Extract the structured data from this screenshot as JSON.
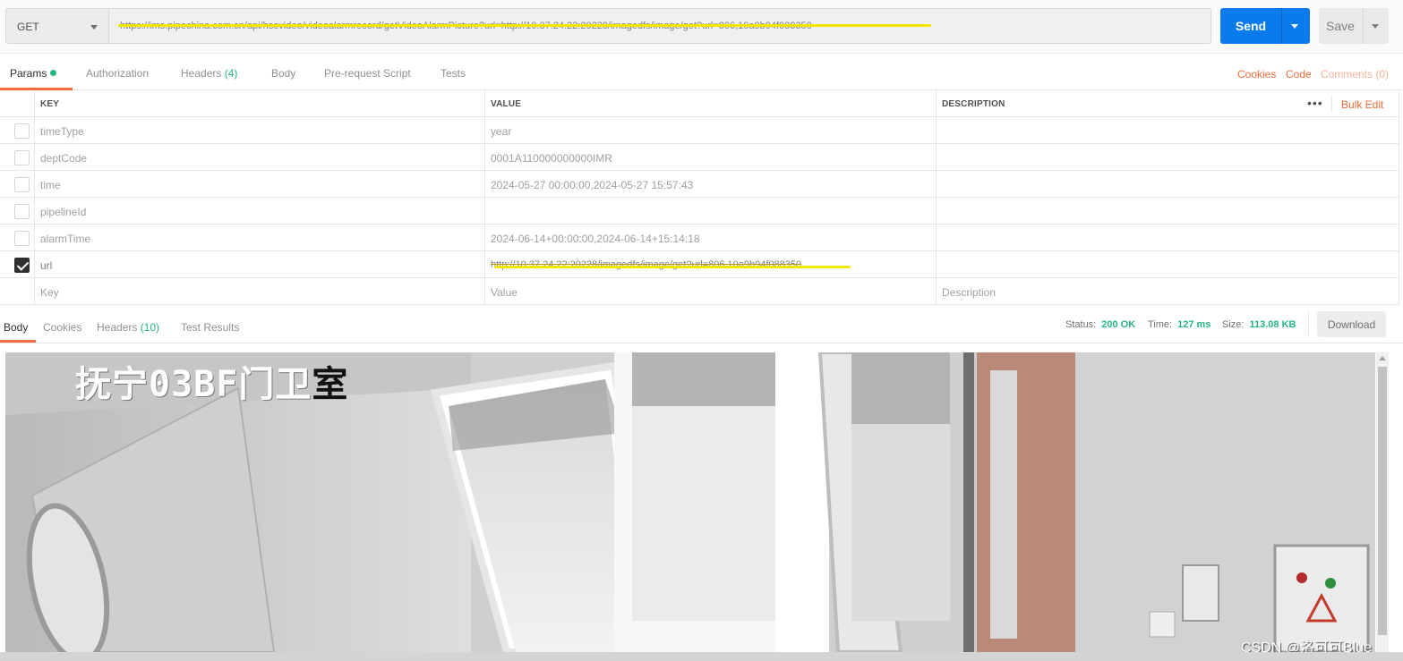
{
  "request": {
    "method": "GET",
    "url": "https://ims.pipechina.com.cn/api/hsevideo/videoalarmrecord/getVideoAlarmPicture?url=http://10.37.24.22:20228/imagedfs/image/get?url=806,10a9b94f088350",
    "send_label": "Send",
    "save_label": "Save"
  },
  "tabs": {
    "params": "Params",
    "authorization": "Authorization",
    "headers": "Headers",
    "headers_count": "(4)",
    "body": "Body",
    "prerequest": "Pre-request Script",
    "tests": "Tests",
    "cookies": "Cookies",
    "code": "Code",
    "comments": "Comments (0)"
  },
  "params_table": {
    "col_key": "KEY",
    "col_value": "VALUE",
    "col_description": "DESCRIPTION",
    "more": "•••",
    "bulk_edit": "Bulk Edit",
    "rows": [
      {
        "key": "timeType",
        "value": "year",
        "checked": false
      },
      {
        "key": "deptCode",
        "value": "0001A110000000000IMR",
        "checked": false
      },
      {
        "key": "time",
        "value": "2024-05-27 00:00:00,2024-05-27 15:57:43",
        "checked": false
      },
      {
        "key": "pipelineId",
        "value": "",
        "checked": false
      },
      {
        "key": "alarmTime",
        "value": "2024-06-14+00:00:00,2024-06-14+15:14:18",
        "checked": false
      },
      {
        "key": "url",
        "value": "http://10.37.24.22:20228/imagedfs/image/get?url=806,10a9b94f088350",
        "checked": true
      }
    ],
    "placeholder_key": "Key",
    "placeholder_value": "Value",
    "placeholder_description": "Description"
  },
  "response": {
    "tabs": {
      "body": "Body",
      "cookies": "Cookies",
      "headers": "Headers",
      "headers_count": "(10)",
      "test_results": "Test Results"
    },
    "status_label": "Status:",
    "status_value": "200 OK",
    "time_label": "Time:",
    "time_value": "127 ms",
    "size_label": "Size:",
    "size_value": "113.08 KB",
    "download_label": "Download",
    "image_overlay_text": "抚宁03BF门卫",
    "image_overlay_last": "室",
    "watermark": "CSDN @洛可可Blue"
  },
  "colors": {
    "accent": "#f26b3a",
    "send_button": "#097bed",
    "success": "#26b47f",
    "highlight": "#f2e600"
  }
}
